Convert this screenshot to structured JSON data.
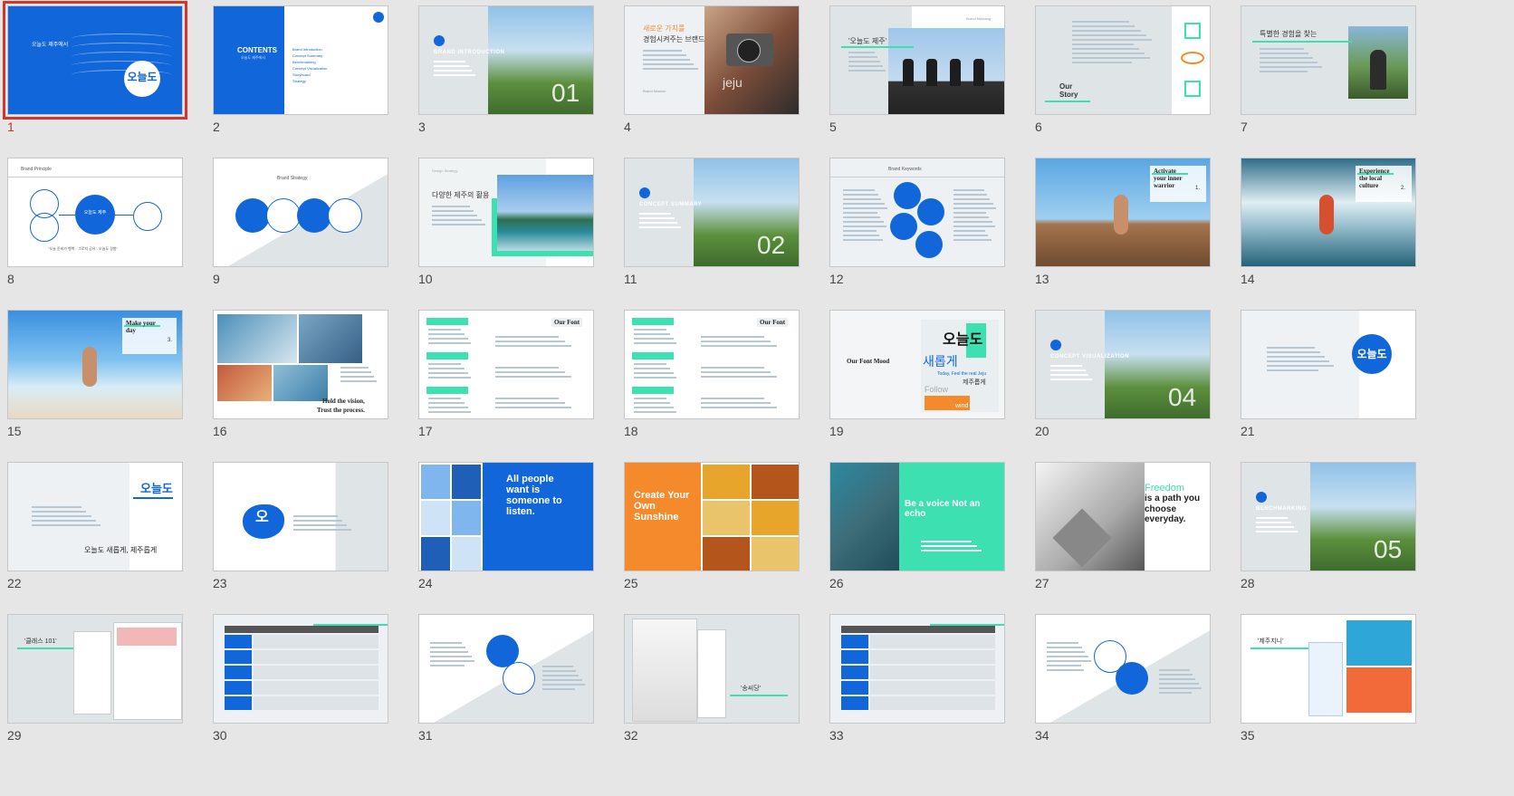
{
  "colors": {
    "blue": "#1166d9",
    "mint": "#3de0b0",
    "orange": "#f48a2b",
    "gray": "#dfe4e7",
    "selection": "#d2372a"
  },
  "selected": 1,
  "slides": [
    {
      "n": "1",
      "kind": "cover",
      "title": "오늘도 제주에서",
      "logo": "오늘도"
    },
    {
      "n": "2",
      "kind": "contents",
      "title": "CONTENTS",
      "sub": "오늘도 제주에서",
      "items": [
        "Brand Introduction",
        "Concept Summary",
        "Benchmarking",
        "Concept Visualization",
        "Storyboard",
        "Strategy"
      ]
    },
    {
      "n": "3",
      "kind": "photo-section",
      "title": "BRAND INTRODUCTION",
      "big": "01"
    },
    {
      "n": "4",
      "kind": "camera",
      "title": "새로운 가치를",
      "title2": "경험시켜주는 브랜드",
      "tag": "Brand Mission",
      "overlay": "jeju"
    },
    {
      "n": "5",
      "kind": "bikes",
      "title": "'오늘도 제주'",
      "tag": "Brand Meaning"
    },
    {
      "n": "6",
      "kind": "story",
      "title": "Our Story"
    },
    {
      "n": "7",
      "kind": "travel",
      "title": "특별한 경험을 찾는"
    },
    {
      "n": "8",
      "kind": "principle",
      "title": "Brand Principle",
      "center": "오늘도 제주",
      "quote": "\"오늘 준비가 행복 - 그로지 공유 - 오늘도 경험\""
    },
    {
      "n": "9",
      "kind": "strategy",
      "title": "Brand Strategy"
    },
    {
      "n": "10",
      "kind": "island",
      "title": "다양한 제주의 활용",
      "tag": "Design Strategy"
    },
    {
      "n": "11",
      "kind": "photo-section",
      "title": "CONCEPT SUMMARY",
      "big": "02"
    },
    {
      "n": "12",
      "kind": "keywords",
      "title": "Brand Keywords"
    },
    {
      "n": "13",
      "kind": "activate",
      "title": "Activate your inner warrior",
      "idx": "1."
    },
    {
      "n": "14",
      "kind": "surf",
      "title": "Experience the local culture",
      "idx": "2."
    },
    {
      "n": "15",
      "kind": "yoga",
      "title": "Make your day",
      "idx": "3."
    },
    {
      "n": "16",
      "kind": "collage",
      "title": "Hold the vision,",
      "title2": "Trust the process."
    },
    {
      "n": "17",
      "kind": "font",
      "title": "Our Font"
    },
    {
      "n": "18",
      "kind": "font",
      "title": "Our Font"
    },
    {
      "n": "19",
      "kind": "mood",
      "title": "Our Font Mood",
      "brand": "오늘도",
      "brand2": "새롭게",
      "line": "Today, Feel the real Jeju",
      "line2": "제주롭게",
      "follow": "Follow",
      "wind": "wind"
    },
    {
      "n": "20",
      "kind": "photo-section",
      "title": "CONCEPT VISUALIZATION",
      "big": "04"
    },
    {
      "n": "21",
      "kind": "logo-right",
      "logo": "오늘도"
    },
    {
      "n": "22",
      "kind": "logotype",
      "logo": "오늘도",
      "tagline": "오늘도 새롭게, 제주롭게"
    },
    {
      "n": "23",
      "kind": "symbol",
      "logo": "오"
    },
    {
      "n": "24",
      "kind": "quote-blue",
      "quote": "All people want is someone to listen."
    },
    {
      "n": "25",
      "kind": "quote-orange",
      "quote": "Create Your Own Sunshine"
    },
    {
      "n": "26",
      "kind": "quote-mint",
      "quote": "Be a voice Not an echo"
    },
    {
      "n": "27",
      "kind": "freedom",
      "word": "Freedom",
      "quote": "is a path you choose everyday."
    },
    {
      "n": "28",
      "kind": "photo-section",
      "title": "BENCHMARKING",
      "big": "05"
    },
    {
      "n": "29",
      "kind": "web",
      "title": "'클래스 101'"
    },
    {
      "n": "30",
      "kind": "table"
    },
    {
      "n": "31",
      "kind": "circles2"
    },
    {
      "n": "32",
      "kind": "web2",
      "title": "'송씨당'"
    },
    {
      "n": "33",
      "kind": "table"
    },
    {
      "n": "34",
      "kind": "circles3"
    },
    {
      "n": "35",
      "kind": "web3",
      "title": "'제주지니'"
    }
  ]
}
